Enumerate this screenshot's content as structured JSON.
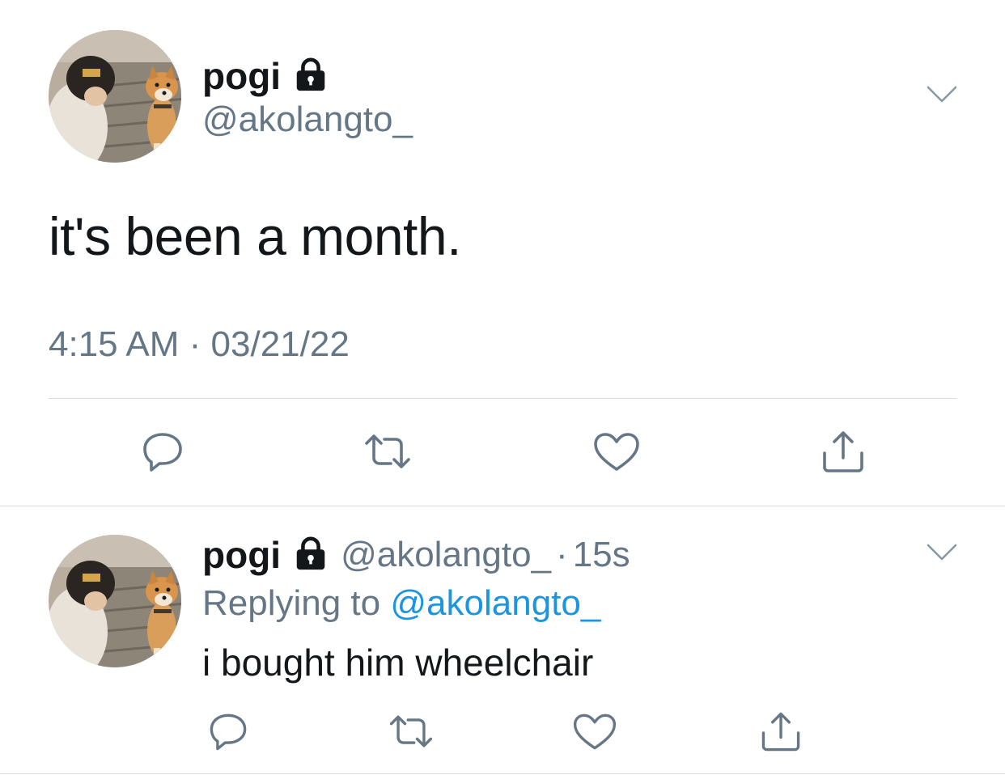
{
  "colors": {
    "text_primary": "#14171a",
    "text_secondary": "#657786",
    "accent_link": "#1b95e0",
    "divider": "#d6dbe0"
  },
  "main_tweet": {
    "display_name": "pogi",
    "handle": "@akolangto_",
    "text": "it's been a month.",
    "timestamp": "4:15 AM · 03/21/22",
    "icons": [
      "lock-icon",
      "chevron-down-icon",
      "reply-icon",
      "retweet-icon",
      "like-icon",
      "share-icon"
    ]
  },
  "reply_tweet": {
    "display_name": "pogi",
    "handle": "@akolangto_",
    "separator": "·",
    "age": "15s",
    "replying_to_label": "Replying to",
    "replying_to_handle": "@akolangto_",
    "text": "i bought him wheelchair",
    "icons": [
      "lock-icon",
      "chevron-down-icon",
      "reply-icon",
      "retweet-icon",
      "like-icon",
      "share-icon"
    ]
  }
}
